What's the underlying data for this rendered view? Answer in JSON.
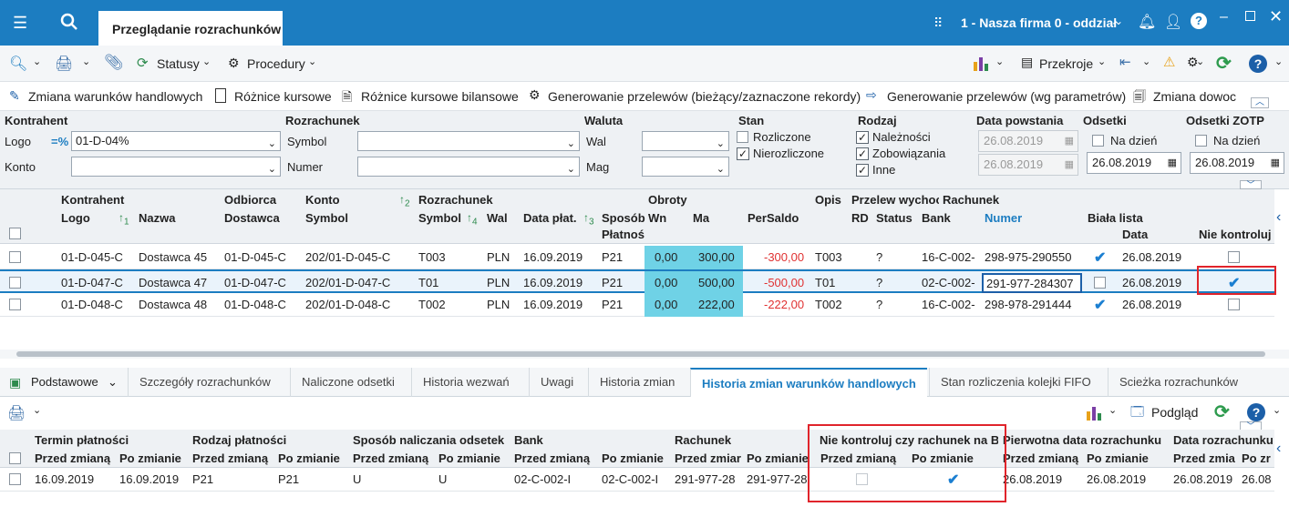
{
  "titlebar": {
    "tab_title": "Przeglądanie rozrachunków",
    "company": "1 - Nasza firma 0 - oddział"
  },
  "toolbar": {
    "statusy": "Statusy",
    "procedury": "Procedury",
    "przekroje": "Przekroje"
  },
  "actions": [
    "Zmiana warunków handlowych",
    "Różnice kursowe",
    "Różnice kursowe bilansowe",
    "Generowanie przelewów (bieżący/zaznaczone rekordy)",
    "Generowanie przelewów (wg parametrów)",
    "Zmiana dowoc"
  ],
  "filter": {
    "kontrahent": "Kontrahent",
    "logo": "Logo",
    "match": "=%",
    "logo_value": "01-D-04%",
    "konto": "Konto",
    "rozrachunek": "Rozrachunek",
    "symbol": "Symbol",
    "numer": "Numer",
    "waluta": "Waluta",
    "wal": "Wal",
    "mag": "Mag",
    "stan": "Stan",
    "rozliczone": "Rozliczone",
    "nierozliczone": "Nierozliczone",
    "rodzaj": "Rodzaj",
    "naleznosci": "Należności",
    "zobowiazania": "Zobowiązania",
    "inne": "Inne",
    "data_powstania": "Data powstania",
    "dp_from": "26.08.2019",
    "dp_to": "26.08.2019",
    "odsetki": "Odsetki",
    "na_dzien": "Na dzień",
    "odsetki_date": "26.08.2019",
    "odsetki_zotp": "Odsetki ZOTP",
    "zotp_date": "26.08.2019"
  },
  "grid": {
    "groups": {
      "kontrahent": "Kontrahent",
      "odbiorca": "Odbiorca",
      "konto": "Konto",
      "rozrachunek": "Rozrachunek",
      "obroty": "Obroty",
      "opis": "Opis",
      "przelew": "Przelew wychoc",
      "rachunek": "Rachunek"
    },
    "cols": {
      "logo": "Logo",
      "nazwa": "Nazwa",
      "dostawca": "Dostawca",
      "symbol": "Symbol",
      "rsymbol": "Symbol",
      "wal": "Wal",
      "data_plat": "Data płat.",
      "sposob": "Sposób",
      "platnos": "Płatnoś",
      "wn": "Wn",
      "ma": "Ma",
      "persaldo": "PerSaldo",
      "rd": "RD",
      "status": "Status",
      "bank": "Bank",
      "numer": "Numer",
      "biala": "Biała lista",
      "data": "Data",
      "nie_kontroluj": "Nie kontroluj"
    },
    "sort": {
      "logo": "1",
      "symbol": "2",
      "rsymbol": "4",
      "data_plat": "3"
    },
    "rows": [
      {
        "logo": "01-D-045-C",
        "nazwa": "Dostawca 45",
        "dostawca": "01-D-045-C",
        "symbol": "202/01-D-045-C",
        "rsymbol": "T003",
        "wal": "PLN",
        "data": "16.09.2019",
        "sposob": "P21",
        "wn": "0,00",
        "ma": "300,00",
        "persaldo": "-300,00",
        "opis": "T003",
        "rd": "?",
        "bank": "16-C-002-",
        "numer": "298-975-290550",
        "biala": true,
        "bdata": "26.08.2019",
        "nk": false
      },
      {
        "logo": "01-D-047-C",
        "nazwa": "Dostawca 47",
        "dostawca": "01-D-047-C",
        "symbol": "202/01-D-047-C",
        "rsymbol": "T01",
        "wal": "PLN",
        "data": "16.09.2019",
        "sposob": "P21",
        "wn": "0,00",
        "ma": "500,00",
        "persaldo": "-500,00",
        "opis": "T01",
        "rd": "?",
        "bank": "02-C-002-",
        "numer": "291-977-284307",
        "biala": false,
        "bdata": "26.08.2019",
        "nk": true
      },
      {
        "logo": "01-D-048-C",
        "nazwa": "Dostawca 48",
        "dostawca": "01-D-048-C",
        "symbol": "202/01-D-048-C",
        "rsymbol": "T002",
        "wal": "PLN",
        "data": "16.09.2019",
        "sposob": "P21",
        "wn": "0,00",
        "ma": "222,00",
        "persaldo": "-222,00",
        "opis": "T002",
        "rd": "?",
        "bank": "16-C-002-",
        "numer": "298-978-291444",
        "biala": true,
        "bdata": "26.08.2019",
        "nk": false
      }
    ]
  },
  "bottom_tabs": {
    "podstawowe": "Podstawowe",
    "tabs": [
      "Szczegóły rozrachunków",
      "Naliczone odsetki",
      "Historia wezwań",
      "Uwagi",
      "Historia zmian",
      "Historia zmian warunków handlowych",
      "Stan rozliczenia kolejki FIFO",
      "Scieżka rozrachunków"
    ]
  },
  "bottom_toolbar": {
    "podglad": "Podgląd"
  },
  "history": {
    "groups": {
      "termin": "Termin płatności",
      "rodzaj": "Rodzaj płatności",
      "sposob": "Sposób naliczania odsetek",
      "bank": "Bank",
      "rachunek": "Rachunek",
      "nie_kontroluj": "Nie kontroluj czy rachunek na B",
      "pierwotna": "Pierwotna data rozrachunku",
      "data_rozr": "Data rozrachunku"
    },
    "przed": "Przed zmianą",
    "po": "Po zmianie",
    "przed_short": "Przed zmiar",
    "po_short": "Po zmianie",
    "przed_dr": "Przed zmia",
    "po_dr": "Po zr",
    "row": {
      "t1": "16.09.2019",
      "t2": "16.09.2019",
      "r1": "P21",
      "r2": "P21",
      "s1": "U",
      "s2": "U",
      "b1": "02-C-002-I",
      "b2": "02-C-002-I",
      "ra1": "291-977-28",
      "ra2": "291-977-28",
      "p1": "26.08.2019",
      "p2": "26.08.2019",
      "d1": "26.08.2019",
      "d2": "26.08"
    }
  },
  "colors": {
    "accent": "#1c7dc1",
    "cyan": "#6fd2e6",
    "negative": "#e03232",
    "highlight": "#e0242b"
  }
}
